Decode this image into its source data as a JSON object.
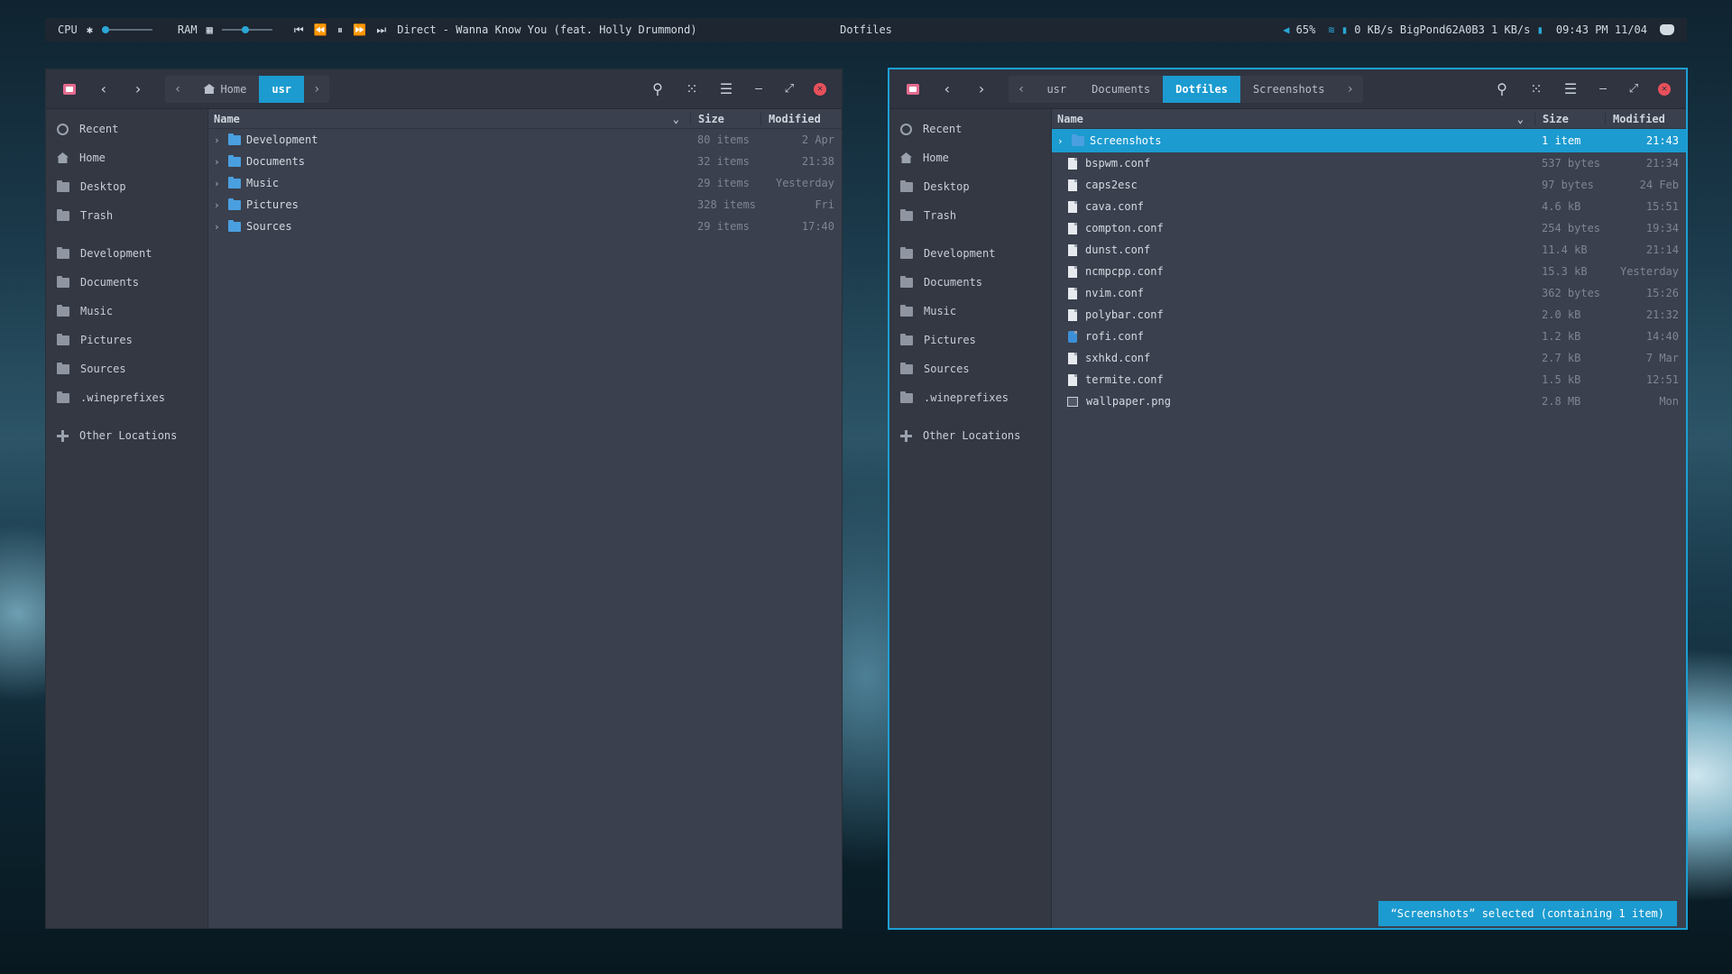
{
  "topbar": {
    "cpu_label": "CPU",
    "ram_label": "RAM",
    "media_controls": "⏮ ⏪ ⏸ ⏩ ⏭",
    "now_playing": "Direct - Wanna Know You (feat. Holly Drummond)",
    "window_title": "Dotfiles",
    "volume": "65%",
    "network": "0 KB/s BigPond62A0B3 1 KB/s",
    "clock": "09:43 PM 11/04"
  },
  "sidebar": {
    "places": [
      "Recent",
      "Home",
      "Desktop",
      "Trash"
    ],
    "bookmarks": [
      "Development",
      "Documents",
      "Music",
      "Pictures",
      "Sources",
      ".wineprefixes"
    ],
    "other": "Other Locations"
  },
  "columns": {
    "name": "Name",
    "size": "Size",
    "modified": "Modified"
  },
  "left_window": {
    "path": {
      "home": "Home",
      "current": "usr"
    },
    "rows": [
      {
        "name": "Development",
        "size": "80 items",
        "modified": "2 Apr"
      },
      {
        "name": "Documents",
        "size": "32 items",
        "modified": "21:38"
      },
      {
        "name": "Music",
        "size": "29 items",
        "modified": "Yesterday"
      },
      {
        "name": "Pictures",
        "size": "328 items",
        "modified": "Fri"
      },
      {
        "name": "Sources",
        "size": "29 items",
        "modified": "17:40"
      }
    ]
  },
  "right_window": {
    "path": {
      "p1": "usr",
      "p2": "Documents",
      "current": "Dotfiles",
      "p4": "Screenshots"
    },
    "rows": [
      {
        "name": "Screenshots",
        "size": "1 item",
        "modified": "21:43",
        "kind": "folder"
      },
      {
        "name": "bspwm.conf",
        "size": "537 bytes",
        "modified": "21:34",
        "kind": "doc"
      },
      {
        "name": "caps2esc",
        "size": "97 bytes",
        "modified": "24 Feb",
        "kind": "doc"
      },
      {
        "name": "cava.conf",
        "size": "4.6 kB",
        "modified": "15:51",
        "kind": "doc"
      },
      {
        "name": "compton.conf",
        "size": "254 bytes",
        "modified": "19:34",
        "kind": "doc"
      },
      {
        "name": "dunst.conf",
        "size": "11.4 kB",
        "modified": "21:14",
        "kind": "doc"
      },
      {
        "name": "ncmpcpp.conf",
        "size": "15.3 kB",
        "modified": "Yesterday",
        "kind": "doc"
      },
      {
        "name": "nvim.conf",
        "size": "362 bytes",
        "modified": "15:26",
        "kind": "doc"
      },
      {
        "name": "polybar.conf",
        "size": "2.0 kB",
        "modified": "21:32",
        "kind": "doc"
      },
      {
        "name": "rofi.conf",
        "size": "1.2 kB",
        "modified": "14:40",
        "kind": "doc-blue"
      },
      {
        "name": "sxhkd.conf",
        "size": "2.7 kB",
        "modified": "7 Mar",
        "kind": "doc"
      },
      {
        "name": "termite.conf",
        "size": "1.5 kB",
        "modified": "12:51",
        "kind": "doc"
      },
      {
        "name": "wallpaper.png",
        "size": "2.8 MB",
        "modified": "Mon",
        "kind": "image"
      }
    ],
    "status": "“Screenshots” selected (containing 1 item)"
  },
  "colors": {
    "accent": "#1c9bd0",
    "window_bg": "#3a404d",
    "sidebar_bg": "#333843",
    "header_bg": "#2f3440",
    "close": "#e8505b"
  }
}
